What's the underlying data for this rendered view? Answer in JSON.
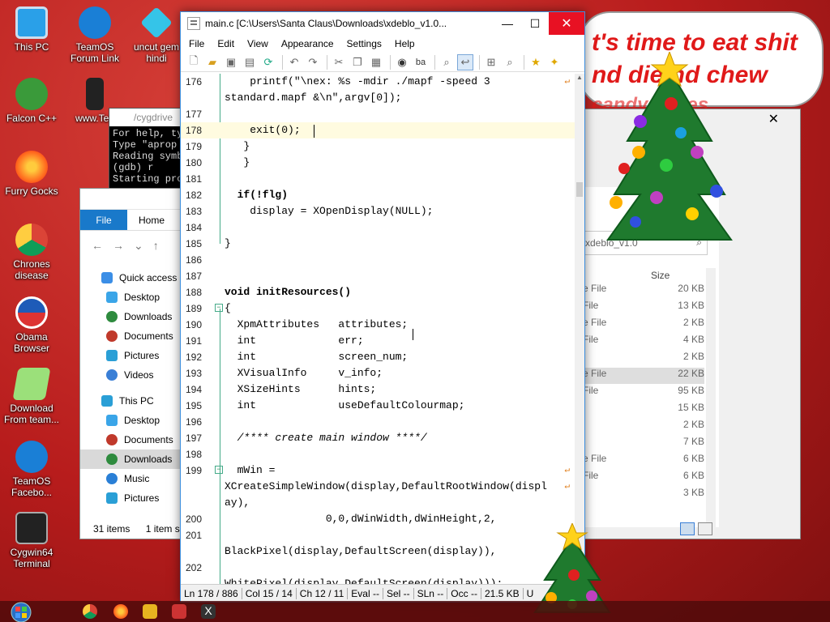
{
  "desktop": {
    "icons": [
      {
        "label": "This PC"
      },
      {
        "label": "TeamOS Forum Link"
      },
      {
        "label": "uncut gem hindi"
      },
      {
        "label": "Falcon C++"
      },
      {
        "label": "www.Tea"
      },
      {
        "label": "Furry Gocks"
      },
      {
        "label": "Chrones disease"
      },
      {
        "label": "Obama Browser"
      },
      {
        "label": "Download From team..."
      },
      {
        "label": "TeamOS Facebo..."
      },
      {
        "label": "Cygwin64 Terminal"
      }
    ],
    "banner_lines": [
      "t's time to eat shit",
      "nd die  nd chew",
      "candy canes"
    ]
  },
  "cygwin": {
    "title": "/cygdrive",
    "lines": [
      "For help, ty",
      "Type \"aprop",
      "Reading symb",
      "(gdb) r",
      "Starting pro"
    ]
  },
  "explorer_left": {
    "ribbon_file": "File",
    "ribbon_home": "Home",
    "tree": [
      {
        "label": "Quick access"
      },
      {
        "label": "Desktop"
      },
      {
        "label": "Downloads"
      },
      {
        "label": "Documents"
      },
      {
        "label": "Pictures"
      },
      {
        "label": "Videos"
      },
      {
        "label": "This PC"
      },
      {
        "label": "Desktop"
      },
      {
        "label": "Documents"
      },
      {
        "label": "Downloads"
      },
      {
        "label": "Music"
      },
      {
        "label": "Pictures"
      }
    ],
    "status_items": "31 items",
    "status_selected": "1 item s"
  },
  "explorer_right": {
    "search_text": "xdeblo_v1.0",
    "size_header": "Size",
    "rows": [
      {
        "type": "e File",
        "size": "20 KB"
      },
      {
        "type": "File",
        "size": "13 KB"
      },
      {
        "type": "e File",
        "size": "2 KB"
      },
      {
        "type": "File",
        "size": "4 KB"
      },
      {
        "type": "",
        "size": "2 KB"
      },
      {
        "type": "e File",
        "size": "22 KB"
      },
      {
        "type": "File",
        "size": "95 KB"
      },
      {
        "type": "",
        "size": "15 KB"
      },
      {
        "type": "",
        "size": "2 KB"
      },
      {
        "type": "",
        "size": "7 KB"
      },
      {
        "type": "e File",
        "size": "6 KB"
      },
      {
        "type": "File",
        "size": "6 KB"
      },
      {
        "type": "",
        "size": "3 KB"
      }
    ]
  },
  "editor": {
    "title": "main.c [C:\\Users\\Santa Claus\\Downloads\\xdeblo_v1.0...",
    "menu": [
      "File",
      "Edit",
      "View",
      "Appearance",
      "Settings",
      "Help"
    ],
    "lines": [
      {
        "num": "176",
        "code": "    printf(\"\\nex: %s -mdir ./mapf -speed 3"
      },
      {
        "num": "",
        "code": "standard.mapf &\\n\",argv[0]);"
      },
      {
        "num": "177",
        "code": ""
      },
      {
        "num": "178",
        "code": "    exit(0);"
      },
      {
        "num": "179",
        "code": "   }"
      },
      {
        "num": "180",
        "code": "   }"
      },
      {
        "num": "181",
        "code": ""
      },
      {
        "num": "182",
        "code": "  if(!flg)"
      },
      {
        "num": "183",
        "code": "    display = XOpenDisplay(NULL);"
      },
      {
        "num": "184",
        "code": ""
      },
      {
        "num": "185",
        "code": "}"
      },
      {
        "num": "186",
        "code": ""
      },
      {
        "num": "187",
        "code": ""
      },
      {
        "num": "188",
        "code": "void initResources()"
      },
      {
        "num": "189",
        "code": "{"
      },
      {
        "num": "190",
        "code": "  XpmAttributes   attributes;"
      },
      {
        "num": "191",
        "code": "  int             err;"
      },
      {
        "num": "192",
        "code": "  int             screen_num;"
      },
      {
        "num": "193",
        "code": "  XVisualInfo     v_info;"
      },
      {
        "num": "194",
        "code": "  XSizeHints      hints;"
      },
      {
        "num": "195",
        "code": "  int             useDefaultColourmap;"
      },
      {
        "num": "196",
        "code": ""
      },
      {
        "num": "197",
        "code": "  /**** create main window ****/"
      },
      {
        "num": "198",
        "code": ""
      },
      {
        "num": "199",
        "code": "  mWin ="
      },
      {
        "num": "",
        "code": "XCreateSimpleWindow(display,DefaultRootWindow(displ"
      },
      {
        "num": "",
        "code": "ay),"
      },
      {
        "num": "200",
        "code": "                0,0,dWinWidth,dWinHeight,2,"
      },
      {
        "num": "201",
        "code": ""
      },
      {
        "num": "",
        "code": "BlackPixel(display,DefaultScreen(display)),"
      },
      {
        "num": "202",
        "code": ""
      },
      {
        "num": "",
        "code": "WhitePixel(display,DefaultScreen(display)));"
      }
    ],
    "status": [
      "Ln 178 / 886",
      "Col 15 / 14",
      "Ch 12 / 11",
      "Eval --",
      "Sel --",
      "SLn --",
      "Occ --",
      "21.5 KB",
      "U"
    ]
  }
}
